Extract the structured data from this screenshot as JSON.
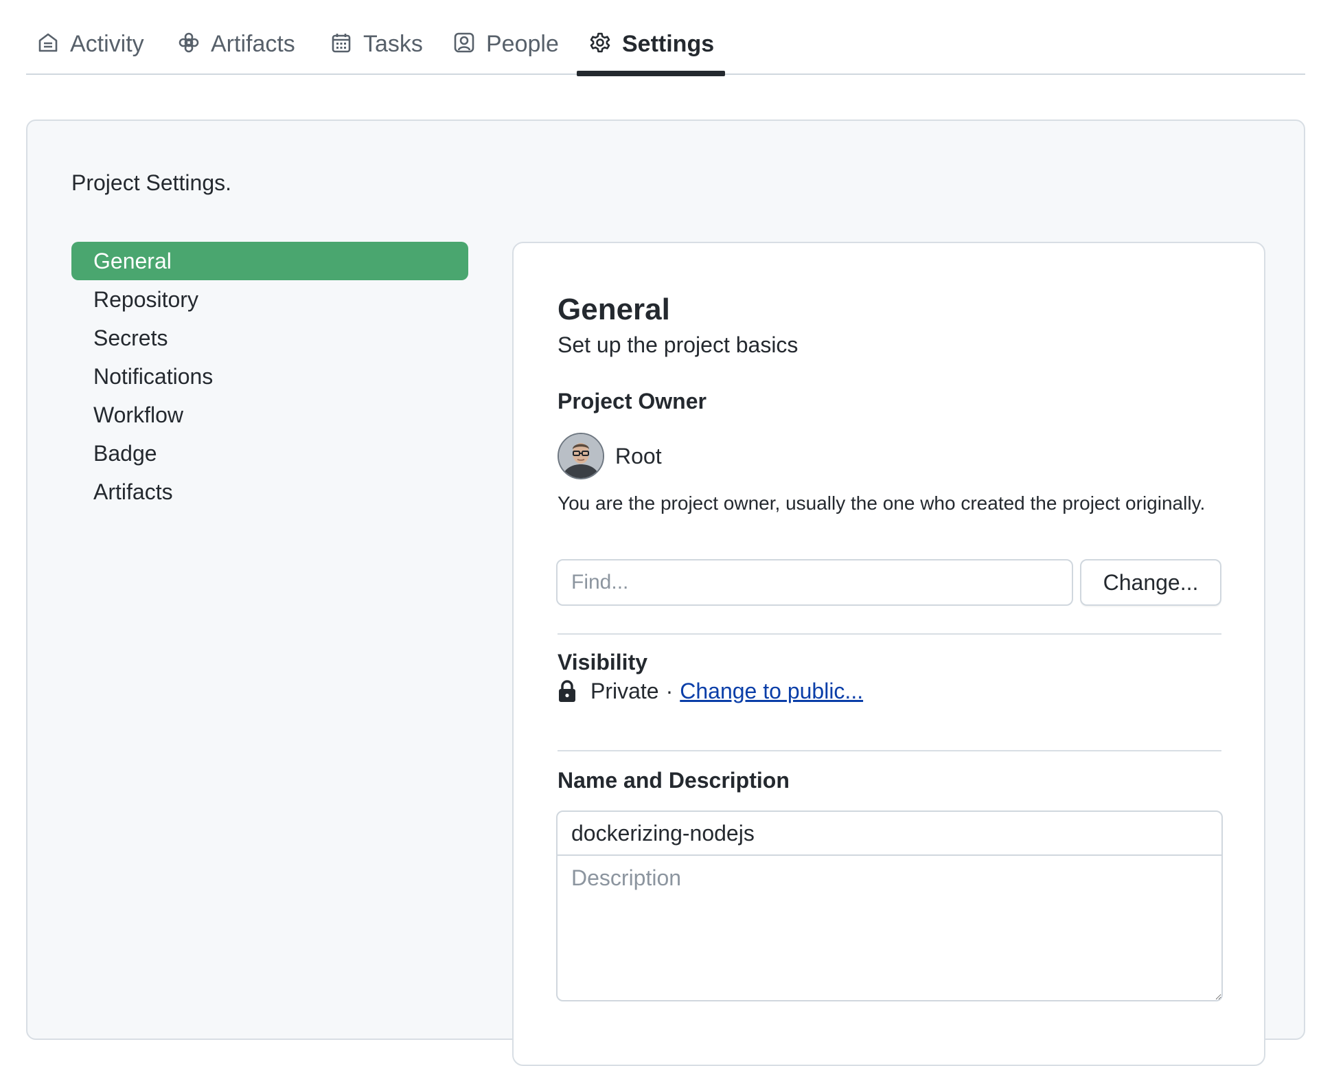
{
  "tabs": [
    {
      "label": "Activity",
      "icon": "home-icon",
      "active": false
    },
    {
      "label": "Artifacts",
      "icon": "artifact-icon",
      "active": false
    },
    {
      "label": "Tasks",
      "icon": "calendar-icon",
      "active": false
    },
    {
      "label": "People",
      "icon": "person-icon",
      "active": false
    },
    {
      "label": "Settings",
      "icon": "gear-icon",
      "active": true
    }
  ],
  "panel": {
    "title": "Project Settings."
  },
  "sidebar": {
    "items": [
      {
        "label": "General",
        "active": true
      },
      {
        "label": "Repository",
        "active": false
      },
      {
        "label": "Secrets",
        "active": false
      },
      {
        "label": "Notifications",
        "active": false
      },
      {
        "label": "Workflow",
        "active": false
      },
      {
        "label": "Badge",
        "active": false
      },
      {
        "label": "Artifacts",
        "active": false
      }
    ]
  },
  "general": {
    "title": "General",
    "subtitle": "Set up the project basics",
    "owner": {
      "heading": "Project Owner",
      "name": "Root",
      "description": "You are the project owner, usually the one who created the project originally.",
      "find_placeholder": "Find...",
      "change_button": "Change..."
    },
    "visibility": {
      "heading": "Visibility",
      "status": "Private",
      "separator": "·",
      "change_link": "Change to public..."
    },
    "name_description": {
      "heading": "Name and Description",
      "name_value": "dockerizing-nodejs",
      "description_placeholder": "Description"
    }
  },
  "colors": {
    "active_nav": "#4aa66f",
    "link": "#0a3ea8",
    "active_tab_underline": "#24292f"
  }
}
